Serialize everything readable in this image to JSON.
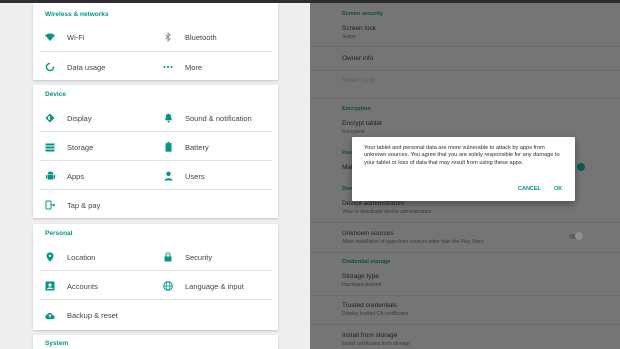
{
  "colors": {
    "accent": "#009688",
    "icon": "#009688",
    "left_background": "#eeeeee",
    "right_dimmed_background": "#757575"
  },
  "left": {
    "sections": [
      {
        "header": "Wireless & networks",
        "items": [
          {
            "label": "Wi-Fi",
            "icon": "wifi-icon"
          },
          {
            "label": "Bluetooth",
            "icon": "bluetooth-icon"
          },
          {
            "label": "Data usage",
            "icon": "data-usage-icon"
          },
          {
            "label": "More",
            "icon": "more-icon"
          }
        ]
      },
      {
        "header": "Device",
        "items": [
          {
            "label": "Display",
            "icon": "display-icon"
          },
          {
            "label": "Sound & notification",
            "icon": "bell-icon"
          },
          {
            "label": "Storage",
            "icon": "storage-icon"
          },
          {
            "label": "Battery",
            "icon": "battery-icon"
          },
          {
            "label": "Apps",
            "icon": "android-icon"
          },
          {
            "label": "Users",
            "icon": "person-icon"
          },
          {
            "label": "Tap & pay",
            "icon": "tap-pay-icon"
          }
        ]
      },
      {
        "header": "Personal",
        "items": [
          {
            "label": "Location",
            "icon": "location-pin-icon"
          },
          {
            "label": "Security",
            "icon": "lock-icon"
          },
          {
            "label": "Accounts",
            "icon": "account-box-icon"
          },
          {
            "label": "Language & input",
            "icon": "globe-icon"
          },
          {
            "label": "Backup & reset",
            "icon": "cloud-upload-icon"
          }
        ]
      },
      {
        "header": "System",
        "items": []
      }
    ]
  },
  "right": {
    "screen_security_header": "Screen security",
    "screen_lock_title": "Screen lock",
    "screen_lock_value": "Swipe",
    "owner_info_title": "Owner info",
    "smart_lock_title": "Smart Lock",
    "encryption_header": "Encryption",
    "encrypt_title": "Encrypt tablet",
    "encrypt_value": "Encrypted",
    "passwords_header_partial": "Pass",
    "make_passwords_partial": "Mak",
    "device_admin_header_partial": "Devi",
    "device_admin_title": "Device administrators",
    "device_admin_sub": "View or deactivate device administrators",
    "unknown_sources_title": "Unknown sources",
    "unknown_sources_sub": "Allow installation of apps from sources other than the Play Store",
    "credential_header": "Credential storage",
    "storage_type_title": "Storage type",
    "storage_type_value": "Hardware-backed",
    "trusted_title": "Trusted credentials",
    "trusted_sub": "Display trusted CA certificates",
    "install_title": "Install from storage",
    "install_sub": "Install certificates from storage"
  },
  "dialog": {
    "message": "Your tablet and personal data are more vulnerable to attack by apps from unknown sources. You agree that you are solely responsible for any damage to your tablet or loss of data that may result from using these apps.",
    "cancel_label": "CANCEL",
    "ok_label": "OK"
  }
}
